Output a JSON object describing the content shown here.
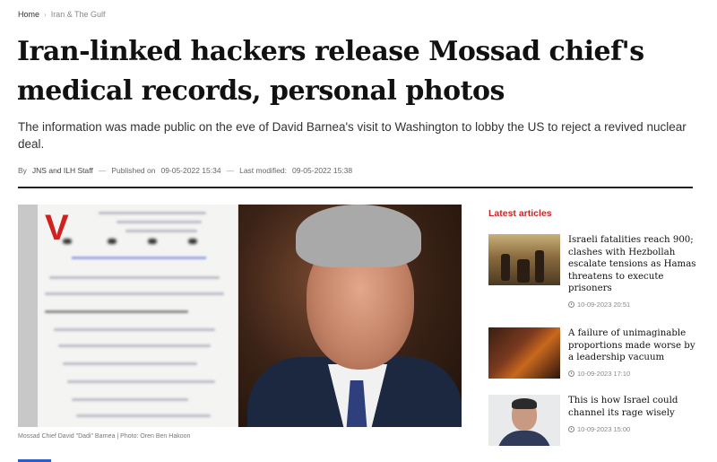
{
  "breadcrumb": {
    "home": "Home",
    "separator": "›",
    "section": "Iran & The Gulf"
  },
  "article": {
    "title": "Iran-linked hackers release Mossad chief's medical records, personal photos",
    "subtitle": "The information was made public on the eve of David Barnea's visit to Washington to lobby the US to reject a revived nuclear deal.",
    "meta": {
      "by_label": "By",
      "author": "JNS and ILH Staff",
      "dash": "—",
      "published_label": "Published on",
      "published": "09-05-2022 15:34",
      "modified_label": "Last modified:",
      "modified": "09-05-2022 15:38"
    },
    "image_caption": "Mossad Chief David \"Dadi\" Barnea | Photo: Oren Ben Hakoon",
    "doc_mark": "V"
  },
  "sidebar": {
    "title": "Latest articles",
    "articles": [
      {
        "title": "Israeli fatalities reach 900; clashes with Hezbollah escalate tensions as Hamas threatens to execute prisoners",
        "time": "10-09-2023 20:51",
        "thumb": "crowd-scene"
      },
      {
        "title": "A failure of unimaginable proportions made worse by a leadership vacuum",
        "time": "10-09-2023 17:10",
        "thumb": "night-scene"
      },
      {
        "title": "This is how Israel could channel its rage wisely",
        "time": "10-09-2023 15:00",
        "thumb": "portrait"
      }
    ]
  },
  "colors": {
    "accent_red": "#c62828",
    "accent_blue": "#2a5ec9",
    "rule": "#222222"
  }
}
